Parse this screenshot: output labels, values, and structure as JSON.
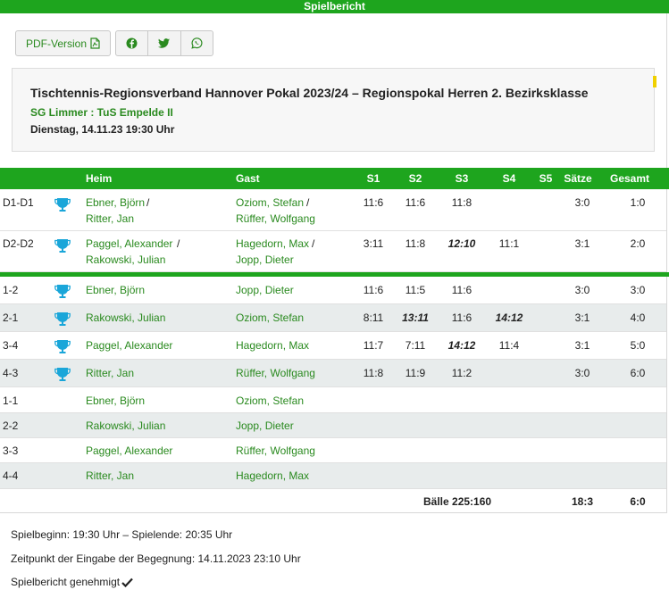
{
  "header": {
    "title": "Spielbericht"
  },
  "toolbar": {
    "pdf_label": "PDF-Version"
  },
  "match": {
    "title": "Tischtennis-Regionsverband Hannover Pokal 2023/24 – Regionspokal Herren 2. Bezirksklasse",
    "teams": "SG Limmer : TuS Empelde II",
    "datetime": "Dienstag, 14.11.23 19:30 Uhr"
  },
  "table": {
    "headers": {
      "heim": "Heim",
      "gast": "Gast",
      "s1": "S1",
      "s2": "S2",
      "s3": "S3",
      "s4": "S4",
      "s5": "S5",
      "saetze": "Sätze",
      "gesamt": "Gesamt"
    },
    "doubles": [
      {
        "code": "D1-D1",
        "heim1": "Ebner, Björn",
        "heim2": "Ritter, Jan",
        "gast1": "Oziom, Stefan",
        "gast2": "Rüffer, Wolfgang",
        "s1": "11:6",
        "s2": "11:6",
        "s3": "11:8",
        "s4": "",
        "s5": "",
        "saetze": "3:0",
        "gesamt": "1:0"
      },
      {
        "code": "D2-D2",
        "heim1": "Paggel, Alexander",
        "heim2": "Rakowski, Julian",
        "gast1": "Hagedorn, Max",
        "gast2": "Jopp, Dieter",
        "s1": "3:11",
        "s2": "11:8",
        "s3": "12:10",
        "s4": "11:1",
        "s5": "",
        "saetze": "3:1",
        "gesamt": "2:0"
      }
    ],
    "singles": [
      {
        "code": "1-2",
        "heim": "Ebner, Björn",
        "gast": "Jopp, Dieter",
        "s1": "11:6",
        "s2": "11:5",
        "s3": "11:6",
        "s4": "",
        "saetze": "3:0",
        "gesamt": "3:0"
      },
      {
        "code": "2-1",
        "heim": "Rakowski, Julian",
        "gast": "Oziom, Stefan",
        "s1": "8:11",
        "s2": "13:11",
        "s3": "11:6",
        "s4": "14:12",
        "saetze": "3:1",
        "gesamt": "4:0"
      },
      {
        "code": "3-4",
        "heim": "Paggel, Alexander",
        "gast": "Hagedorn, Max",
        "s1": "11:7",
        "s2": "7:11",
        "s3": "14:12",
        "s4": "11:4",
        "saetze": "3:1",
        "gesamt": "5:0"
      },
      {
        "code": "4-3",
        "heim": "Ritter, Jan",
        "gast": "Rüffer, Wolfgang",
        "s1": "11:8",
        "s2": "11:9",
        "s3": "11:2",
        "s4": "",
        "saetze": "3:0",
        "gesamt": "6:0"
      },
      {
        "code": "1-1",
        "heim": "Ebner, Björn",
        "gast": "Oziom, Stefan"
      },
      {
        "code": "2-2",
        "heim": "Rakowski, Julian",
        "gast": "Jopp, Dieter"
      },
      {
        "code": "3-3",
        "heim": "Paggel, Alexander",
        "gast": "Rüffer, Wolfgang"
      },
      {
        "code": "4-4",
        "heim": "Ritter, Jan",
        "gast": "Hagedorn, Max"
      }
    ],
    "totals": {
      "baelle": "Bälle 225:160",
      "saetze": "18:3",
      "gesamt": "6:0"
    }
  },
  "footer": {
    "begin_end": "Spielbeginn: 19:30 Uhr – Spielende: 20:35 Uhr",
    "entry_time": "Zeitpunkt der Eingabe der Begegnung: 14.11.2023 23:10 Uhr",
    "approved": "Spielbericht genehmigt"
  },
  "colors": {
    "accent": "#1ea51e",
    "link": "#2a8a1f",
    "trophy": "#1aa6d9"
  },
  "icons": [
    "file-pdf-icon",
    "facebook-icon",
    "twitter-icon",
    "whatsapp-icon",
    "trophy-icon",
    "checkmark-icon"
  ]
}
